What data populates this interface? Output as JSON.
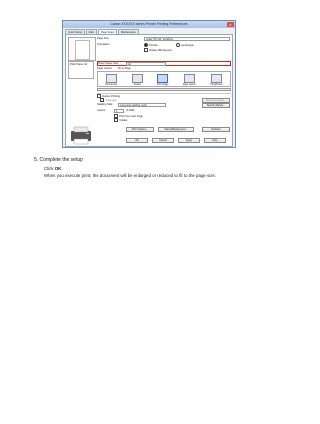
{
  "dialog": {
    "title": "Canon XXXXXX series Printer Printing Preferences",
    "close_label": "x",
    "tabs": [
      "Quick Setup",
      "Main",
      "Page Setup",
      "Maintenance"
    ],
    "preview_label": "Plain Paper A4",
    "page_size_label": "Page Size:",
    "page_size_value": "Letter 8.5\"x11\" 22x28cm",
    "orientation_label": "Orientation:",
    "portrait_label": "Portrait",
    "landscape_label": "Landscape",
    "rotate_label": "Rotate 180 degrees",
    "printer_paper_size_label": "Printer Paper Size:",
    "printer_paper_size_value": "A4",
    "page_layout_label": "Page Layout:",
    "page_layout_value": "Fit-to-Page",
    "layouts": [
      "Normal-size",
      "Scaled",
      "Fit-to-Page",
      "Page Layout",
      "Tiling/Poster"
    ],
    "duplex_label": "Duplex Printing",
    "automatic_label": "Automatic",
    "print_area_btn": "Print Area Setup...",
    "stapling_label": "Stapling Side:",
    "stapling_value": "Long-side stapling (Left)",
    "specify_margin_btn": "Specify Margin...",
    "copies_label": "Copies:",
    "copies_value": "1",
    "copies_unit": "(1-999)",
    "print_last_label": "Print from Last Page",
    "collate_label": "Collate",
    "print_options_btn": "Print Options...",
    "stamp_btn": "Stamp/Background...",
    "defaults_btn": "Defaults",
    "ok_btn": "OK",
    "cancel_btn": "Cancel",
    "apply_btn": "Apply",
    "help_btn": "Help"
  },
  "instructions": {
    "step": "5.  Complete the setup",
    "click_prefix": "Click ",
    "click_target": "OK",
    "click_suffix": ".",
    "description": "When you execute print, the document will be enlarged or reduced to fit to the page size."
  }
}
